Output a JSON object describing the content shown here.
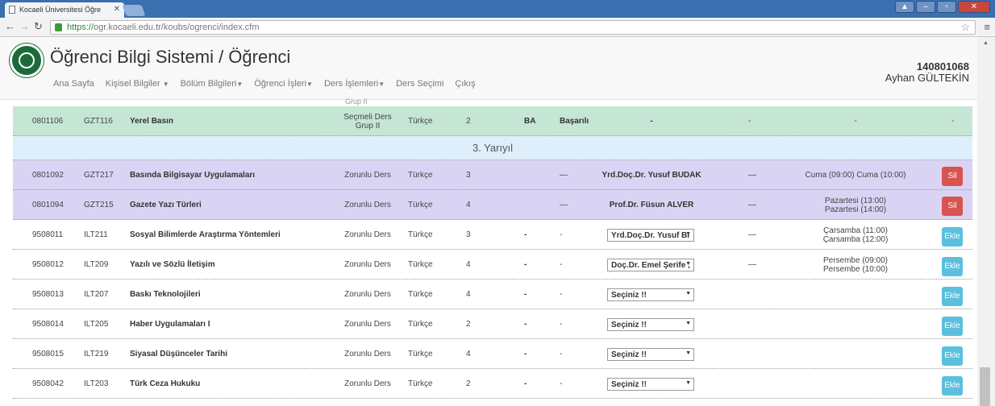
{
  "browser": {
    "tab_title": "Kocaeli Üniversitesi Öğre",
    "url_scheme": "https://",
    "url_rest": "ogr.kocaeli.edu.tr/koubs/ogrenci/index.cfm"
  },
  "header": {
    "title": "Öğrenci Bilgi Sistemi / Öğrenci",
    "student_id": "140801068",
    "student_name": "Ayhan GÜLTEKİN",
    "nav": [
      "Ana Sayfa",
      "Kişisel Bilgiler",
      "Bölüm Bilgileri",
      "Öğrenci İşleri",
      "Ders İşlemleri",
      "Ders Seçimi",
      "Çıkış"
    ]
  },
  "partial_row_text": "Grup II",
  "semester_heading": "3. Yarıyıl",
  "rows": [
    {
      "code": "0801106",
      "course": "GZT116",
      "name": "Yerel Basın",
      "type1": "Seçmeli Ders",
      "type2": "Grup II",
      "lang": "Türkçe",
      "credit": "2",
      "grade": "BA",
      "result": "Başarılı",
      "instructor": "-",
      "dash2": "-",
      "schedule1": "-",
      "schedule2": "",
      "extra": "-",
      "style": "green"
    },
    {
      "code": "0801092",
      "course": "GZT217",
      "name": "Basında Bilgisayar Uygulamaları",
      "type1": "Zorunlu Ders",
      "type2": "",
      "lang": "Türkçe",
      "credit": "3",
      "grade": "",
      "result": "—",
      "instructor": "Yrd.Doç.Dr. Yusuf BUDAK",
      "dash2": "—",
      "schedule1": "Cuma (09:00) Cuma (10:00)",
      "schedule2": "",
      "button": "Sil",
      "style": "purple"
    },
    {
      "code": "0801094",
      "course": "GZT215",
      "name": "Gazete Yazı Türleri",
      "type1": "Zorunlu Ders",
      "type2": "",
      "lang": "Türkçe",
      "credit": "4",
      "grade": "",
      "result": "—",
      "instructor": "Prof.Dr. Füsun ALVER",
      "dash2": "—",
      "schedule1": "Pazartesi (13:00)",
      "schedule2": "Pazartesi (14:00)",
      "button": "Sil",
      "style": "purple"
    },
    {
      "code": "9508011",
      "course": "ILT211",
      "name": "Sosyal Bilimlerde Araştırma Yöntemleri",
      "type1": "Zorunlu Ders",
      "type2": "",
      "lang": "Türkçe",
      "credit": "3",
      "grade": "-",
      "result": "-",
      "select": "Yrd.Doç.Dr. Yusuf BI",
      "dash2": "—",
      "schedule1": "Çarsamba (11:00)",
      "schedule2": "Çarsamba (12:00)",
      "button": "Ekle",
      "style": "white"
    },
    {
      "code": "9508012",
      "course": "ILT209",
      "name": "Yazılı ve Sözlü İletişim",
      "type1": "Zorunlu Ders",
      "type2": "",
      "lang": "Türkçe",
      "credit": "4",
      "grade": "-",
      "result": "-",
      "select": "Doç.Dr. Emel Şerife ,",
      "dash2": "—",
      "schedule1": "Persembe (09:00)",
      "schedule2": "Persembe (10:00)",
      "button": "Ekle",
      "style": "white"
    },
    {
      "code": "9508013",
      "course": "ILT207",
      "name": "Baskı Teknolojileri",
      "type1": "Zorunlu Ders",
      "type2": "",
      "lang": "Türkçe",
      "credit": "4",
      "grade": "-",
      "result": "-",
      "select": "Seçiniz !!",
      "dash2": "",
      "schedule1": "",
      "schedule2": "",
      "button": "Ekle",
      "style": "white"
    },
    {
      "code": "9508014",
      "course": "ILT205",
      "name": "Haber Uygulamaları I",
      "type1": "Zorunlu Ders",
      "type2": "",
      "lang": "Türkçe",
      "credit": "2",
      "grade": "-",
      "result": "-",
      "select": "Seçiniz !!",
      "dash2": "",
      "schedule1": "",
      "schedule2": "",
      "button": "Ekle",
      "style": "white"
    },
    {
      "code": "9508015",
      "course": "ILT219",
      "name": "Siyasal Düşünceler Tarihi",
      "type1": "Zorunlu Ders",
      "type2": "",
      "lang": "Türkçe",
      "credit": "4",
      "grade": "-",
      "result": "-",
      "select": "Seçiniz !!",
      "dash2": "",
      "schedule1": "",
      "schedule2": "",
      "button": "Ekle",
      "style": "white"
    },
    {
      "code": "9508042",
      "course": "ILT203",
      "name": "Türk Ceza Hukuku",
      "type1": "Zorunlu Ders",
      "type2": "",
      "lang": "Türkçe",
      "credit": "2",
      "grade": "-",
      "result": "-",
      "select": "Seçiniz !!",
      "dash2": "",
      "schedule1": "",
      "schedule2": "",
      "button": "Ekle",
      "style": "white"
    }
  ]
}
